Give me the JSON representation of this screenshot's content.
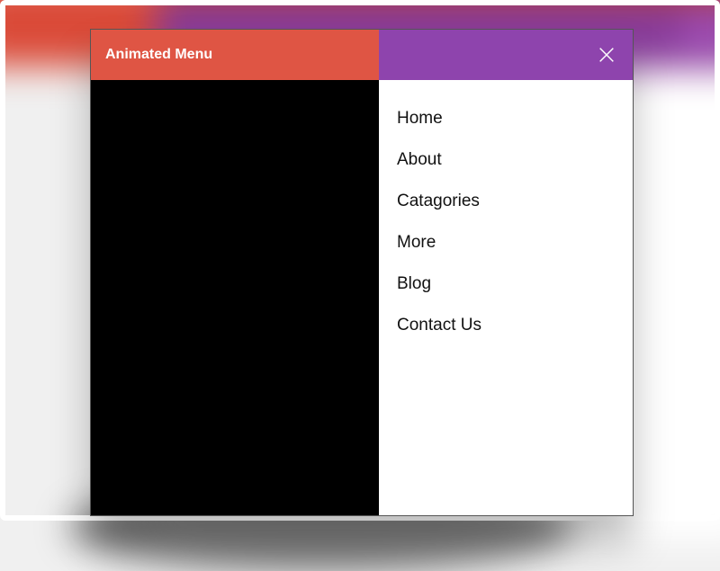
{
  "header": {
    "title": "Animated Menu"
  },
  "menu": {
    "items": [
      {
        "label": "Home"
      },
      {
        "label": "About"
      },
      {
        "label": "Catagories"
      },
      {
        "label": "More"
      },
      {
        "label": "Blog"
      },
      {
        "label": "Contact Us"
      }
    ]
  },
  "colors": {
    "accent_red": "#df5544",
    "accent_purple": "#8e44ad"
  }
}
